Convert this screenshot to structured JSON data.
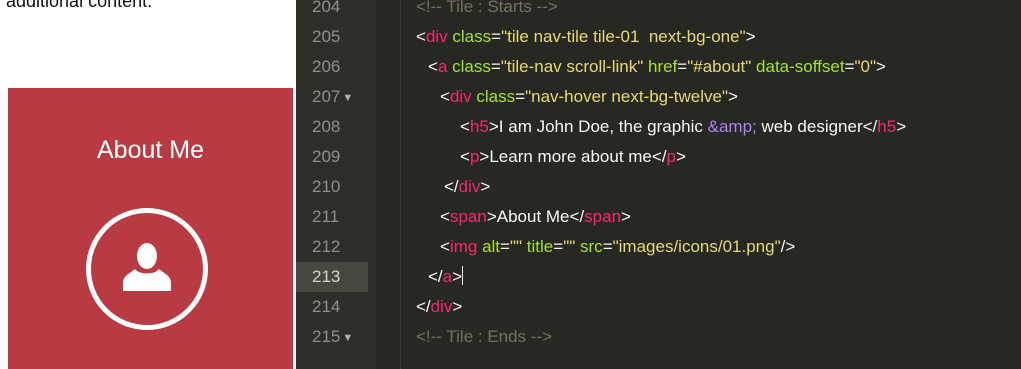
{
  "top_clip_text": "additional content.",
  "tile": {
    "title": "About Me",
    "bg_color": "#b83b44",
    "icon": "user-icon"
  },
  "editor": {
    "theme": "monokai",
    "active_line": 213,
    "lines": [
      {
        "num": "204",
        "fold": "",
        "tokens": [
          {
            "t": "comment",
            "v": "<!-- Tile : Starts -->"
          }
        ]
      },
      {
        "num": "205",
        "fold": "",
        "tokens": [
          {
            "t": "punct",
            "v": "<"
          },
          {
            "t": "tag",
            "v": "div"
          },
          {
            "t": "punct",
            "v": " "
          },
          {
            "t": "attr",
            "v": "class"
          },
          {
            "t": "punct",
            "v": "="
          },
          {
            "t": "str",
            "v": "\"tile nav-tile tile-01  next-bg-one\""
          },
          {
            "t": "punct",
            "v": ">"
          }
        ]
      },
      {
        "num": "206",
        "fold": "",
        "tokens": [
          {
            "t": "punct",
            "v": "<"
          },
          {
            "t": "tag",
            "v": "a"
          },
          {
            "t": "punct",
            "v": " "
          },
          {
            "t": "attr",
            "v": "class"
          },
          {
            "t": "punct",
            "v": "="
          },
          {
            "t": "str",
            "v": "\"tile-nav scroll-link\""
          },
          {
            "t": "punct",
            "v": " "
          },
          {
            "t": "attr",
            "v": "href"
          },
          {
            "t": "punct",
            "v": "="
          },
          {
            "t": "str",
            "v": "\"#about\""
          },
          {
            "t": "punct",
            "v": " "
          },
          {
            "t": "attr",
            "v": "data-soffset"
          },
          {
            "t": "punct",
            "v": "="
          },
          {
            "t": "str",
            "v": "\"0\""
          },
          {
            "t": "punct",
            "v": ">"
          }
        ]
      },
      {
        "num": "207",
        "fold": "▼",
        "tokens": [
          {
            "t": "punct",
            "v": "<"
          },
          {
            "t": "tag",
            "v": "div"
          },
          {
            "t": "punct",
            "v": " "
          },
          {
            "t": "attr",
            "v": "class"
          },
          {
            "t": "punct",
            "v": "="
          },
          {
            "t": "str",
            "v": "\"nav-hover next-bg-twelve\""
          },
          {
            "t": "punct",
            "v": ">"
          }
        ]
      },
      {
        "num": "208",
        "fold": "",
        "tokens": [
          {
            "t": "punct",
            "v": "<"
          },
          {
            "t": "tag",
            "v": "h5"
          },
          {
            "t": "punct",
            "v": ">"
          },
          {
            "t": "text",
            "v": "I am John Doe, the graphic "
          },
          {
            "t": "ent",
            "v": "&amp;"
          },
          {
            "t": "text",
            "v": " web designer"
          },
          {
            "t": "punct",
            "v": "</"
          },
          {
            "t": "tag",
            "v": "h5"
          },
          {
            "t": "punct",
            "v": ">"
          }
        ]
      },
      {
        "num": "209",
        "fold": "",
        "tokens": [
          {
            "t": "punct",
            "v": "<"
          },
          {
            "t": "tag",
            "v": "p"
          },
          {
            "t": "punct",
            "v": ">"
          },
          {
            "t": "text",
            "v": "Learn more about me"
          },
          {
            "t": "punct",
            "v": "</"
          },
          {
            "t": "tag",
            "v": "p"
          },
          {
            "t": "punct",
            "v": ">"
          }
        ]
      },
      {
        "num": "210",
        "fold": "",
        "tokens": [
          {
            "t": "punct",
            "v": "</"
          },
          {
            "t": "tag",
            "v": "div"
          },
          {
            "t": "punct",
            "v": ">"
          }
        ]
      },
      {
        "num": "211",
        "fold": "",
        "tokens": [
          {
            "t": "punct",
            "v": "<"
          },
          {
            "t": "tag",
            "v": "span"
          },
          {
            "t": "punct",
            "v": ">"
          },
          {
            "t": "text",
            "v": "About Me"
          },
          {
            "t": "punct",
            "v": "</"
          },
          {
            "t": "tag",
            "v": "span"
          },
          {
            "t": "punct",
            "v": ">"
          }
        ]
      },
      {
        "num": "212",
        "fold": "",
        "tokens": [
          {
            "t": "punct",
            "v": "<"
          },
          {
            "t": "tag",
            "v": "img"
          },
          {
            "t": "punct",
            "v": " "
          },
          {
            "t": "attr",
            "v": "alt"
          },
          {
            "t": "punct",
            "v": "="
          },
          {
            "t": "str",
            "v": "\"\""
          },
          {
            "t": "punct",
            "v": " "
          },
          {
            "t": "attr",
            "v": "title"
          },
          {
            "t": "punct",
            "v": "="
          },
          {
            "t": "str",
            "v": "\"\""
          },
          {
            "t": "punct",
            "v": " "
          },
          {
            "t": "attr",
            "v": "src"
          },
          {
            "t": "punct",
            "v": "="
          },
          {
            "t": "str",
            "v": "\"images/icons/01.png\""
          },
          {
            "t": "punct",
            "v": "/>"
          }
        ]
      },
      {
        "num": "213",
        "fold": "",
        "tokens": [
          {
            "t": "punct",
            "v": "</"
          },
          {
            "t": "tag",
            "v": "a"
          },
          {
            "t": "punct",
            "v": ">"
          }
        ]
      },
      {
        "num": "214",
        "fold": "",
        "tokens": [
          {
            "t": "punct",
            "v": "</"
          },
          {
            "t": "tag",
            "v": "div"
          },
          {
            "t": "punct",
            "v": ">"
          }
        ]
      },
      {
        "num": "215",
        "fold": "▼",
        "tokens": [
          {
            "t": "comment",
            "v": "<!-- Tile : Ends -->"
          }
        ]
      }
    ]
  }
}
